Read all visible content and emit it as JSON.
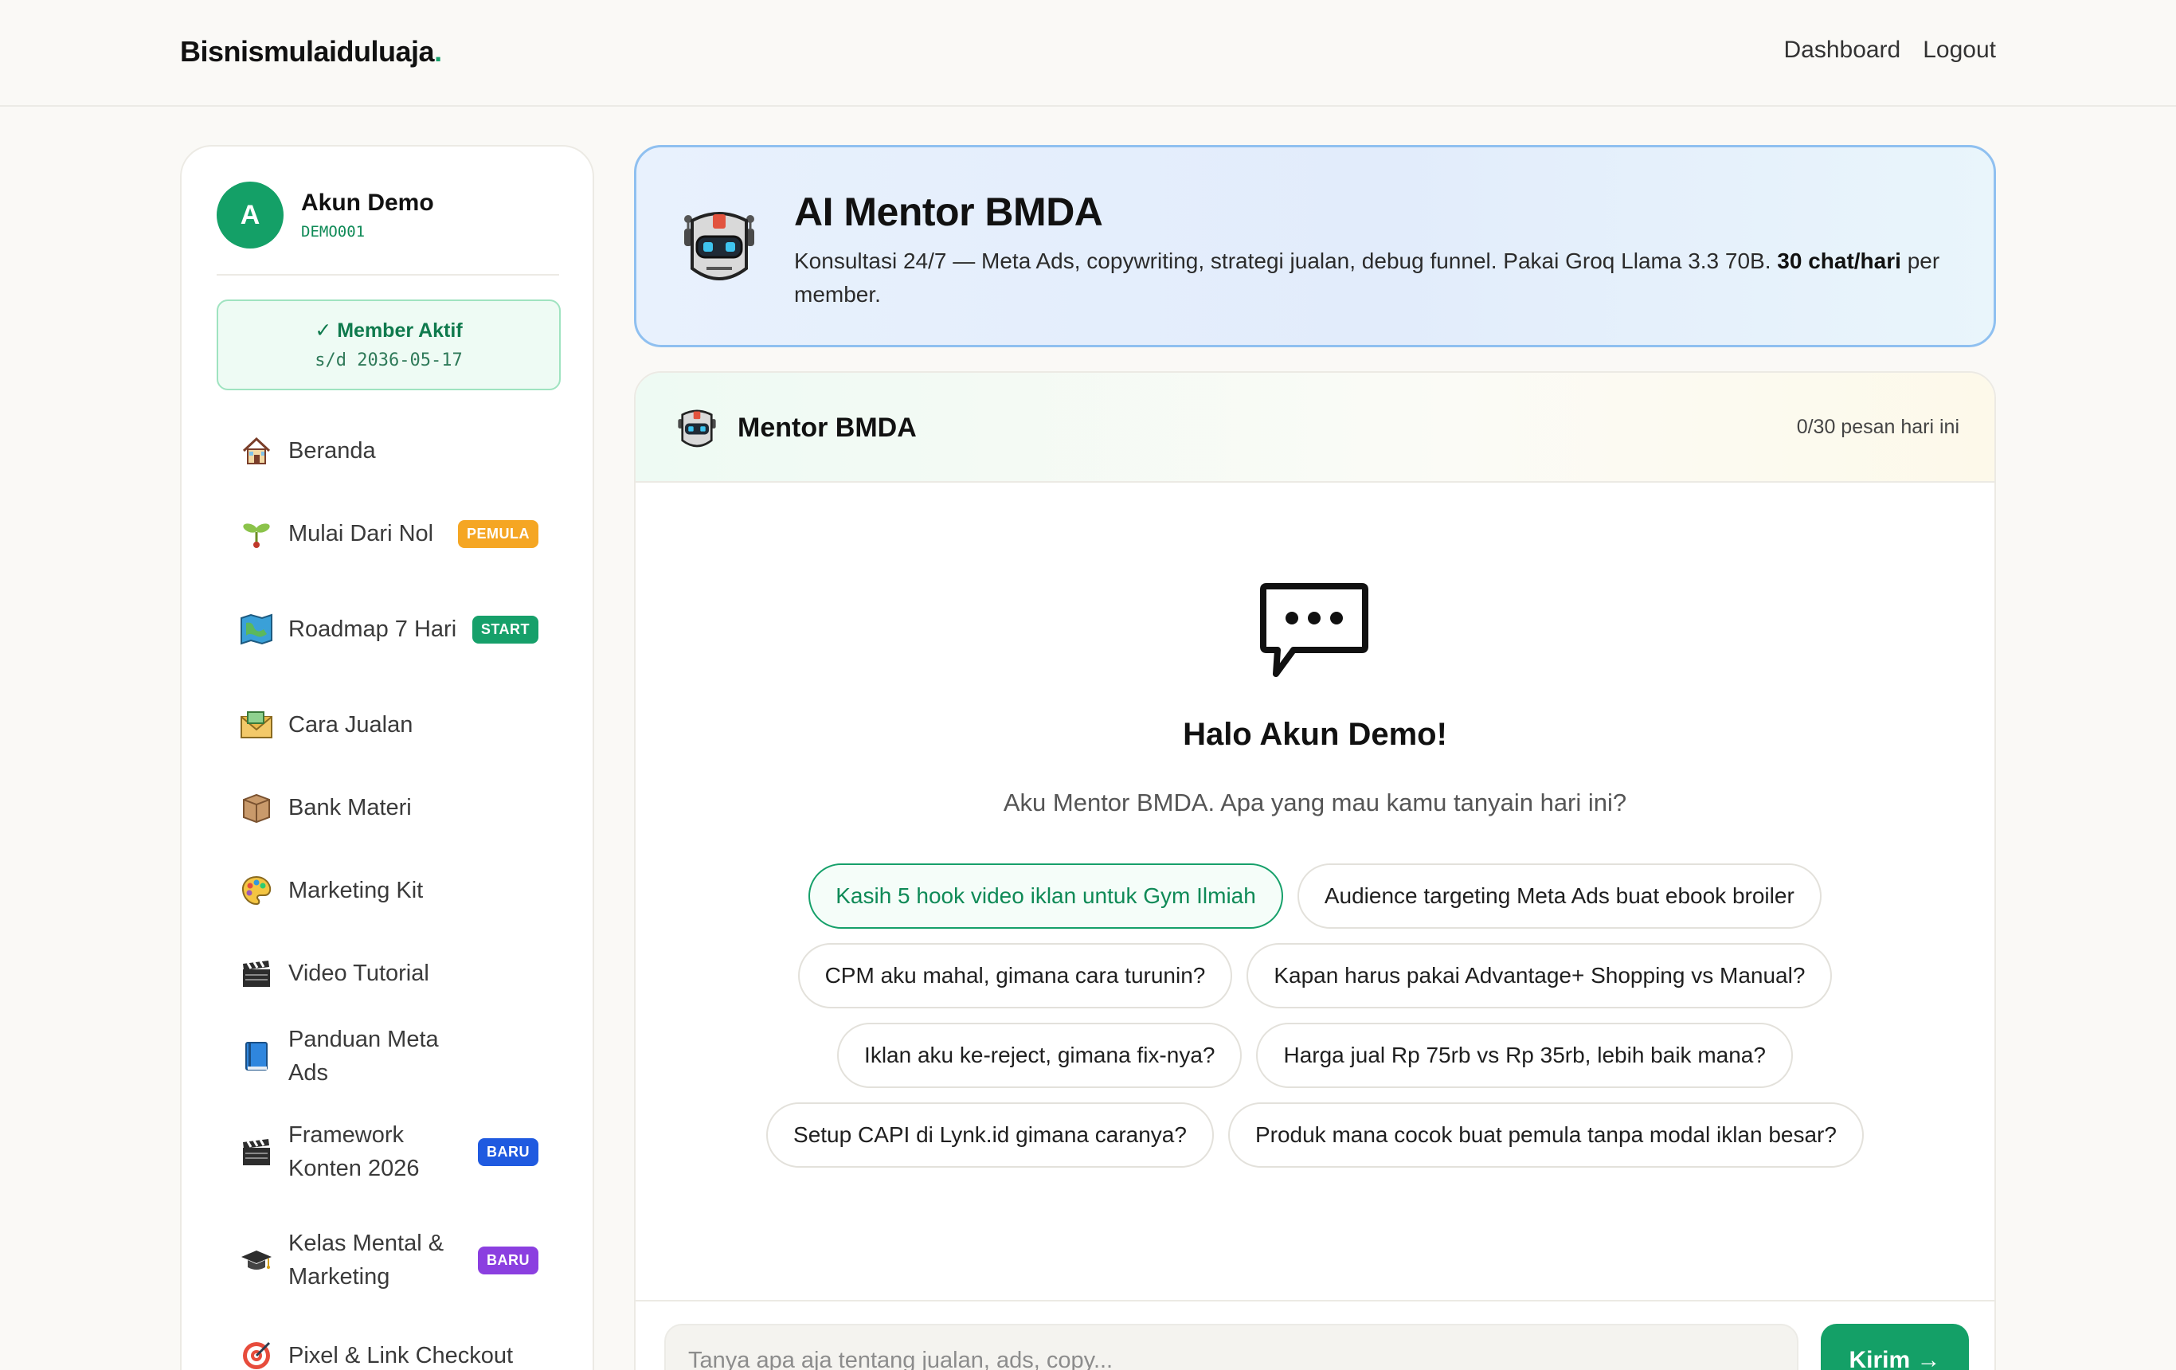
{
  "brand": {
    "name": "Bisnismulaiduluaja",
    "dot": "."
  },
  "topnav": {
    "dashboard": "Dashboard",
    "logout": "Logout"
  },
  "profile": {
    "initial": "A",
    "name": "Akun Demo",
    "code": "DEMO001"
  },
  "membership": {
    "status": "✓ Member Aktif",
    "until": "s/d 2036-05-17"
  },
  "sidebar": {
    "items": [
      {
        "label": "Beranda",
        "icon": "house-icon"
      },
      {
        "label": "Mulai Dari Nol",
        "icon": "seedling-icon",
        "badge": "PEMULA"
      },
      {
        "label": "Roadmap 7 Hari",
        "icon": "map-icon",
        "badge": "START"
      },
      {
        "label": "Cara Jualan",
        "icon": "money-envelope-icon"
      },
      {
        "label": "Bank Materi",
        "icon": "package-icon"
      },
      {
        "label": "Marketing Kit",
        "icon": "palette-icon"
      },
      {
        "label": "Video Tutorial",
        "icon": "clapperboard-icon"
      },
      {
        "label": "Panduan Meta Ads",
        "icon": "book-icon"
      },
      {
        "label": "Framework Konten 2026",
        "icon": "clapperboard-icon",
        "badge": "BARU"
      },
      {
        "label": "Kelas Mental & Marketing",
        "icon": "graduation-cap-icon",
        "badge": "BARU"
      },
      {
        "label": "Pixel & Link Checkout",
        "icon": "target-icon"
      }
    ]
  },
  "colors": {
    "accent": "#14a067",
    "badge_pemula": "#f5a623",
    "badge_start": "#16a06a",
    "badge_baru_blue": "#1f5ae0",
    "badge_baru_purple": "#8b3fe0"
  },
  "hero": {
    "title": "AI Mentor BMDA",
    "desc_prefix": "Konsultasi 24/7 — Meta Ads, copywriting, strategi jualan, debug funnel. Pakai Groq Llama 3.3 70B. ",
    "desc_bold": "30 chat/hari",
    "desc_suffix": " per member."
  },
  "chat": {
    "title": "Mentor BMDA",
    "count": "0/30 pesan hari ini",
    "greeting": "Halo Akun Demo!",
    "subtitle": "Aku Mentor BMDA. Apa yang mau kamu tanyain hari ini?",
    "suggestions": [
      "Kasih 5 hook video iklan untuk Gym Ilmiah",
      "Audience targeting Meta Ads buat ebook broiler",
      "CPM aku mahal, gimana cara turunin?",
      "Kapan harus pakai Advantage+ Shopping vs Manual?",
      "Iklan aku ke-reject, gimana fix-nya?",
      "Harga jual Rp 75rb vs Rp 35rb, lebih baik mana?",
      "Setup CAPI di Lynk.id gimana caranya?",
      "Produk mana cocok buat pemula tanpa modal iklan besar?"
    ],
    "input_placeholder": "Tanya apa aja tentang jualan, ads, copy...",
    "send_label": "Kirim →"
  }
}
